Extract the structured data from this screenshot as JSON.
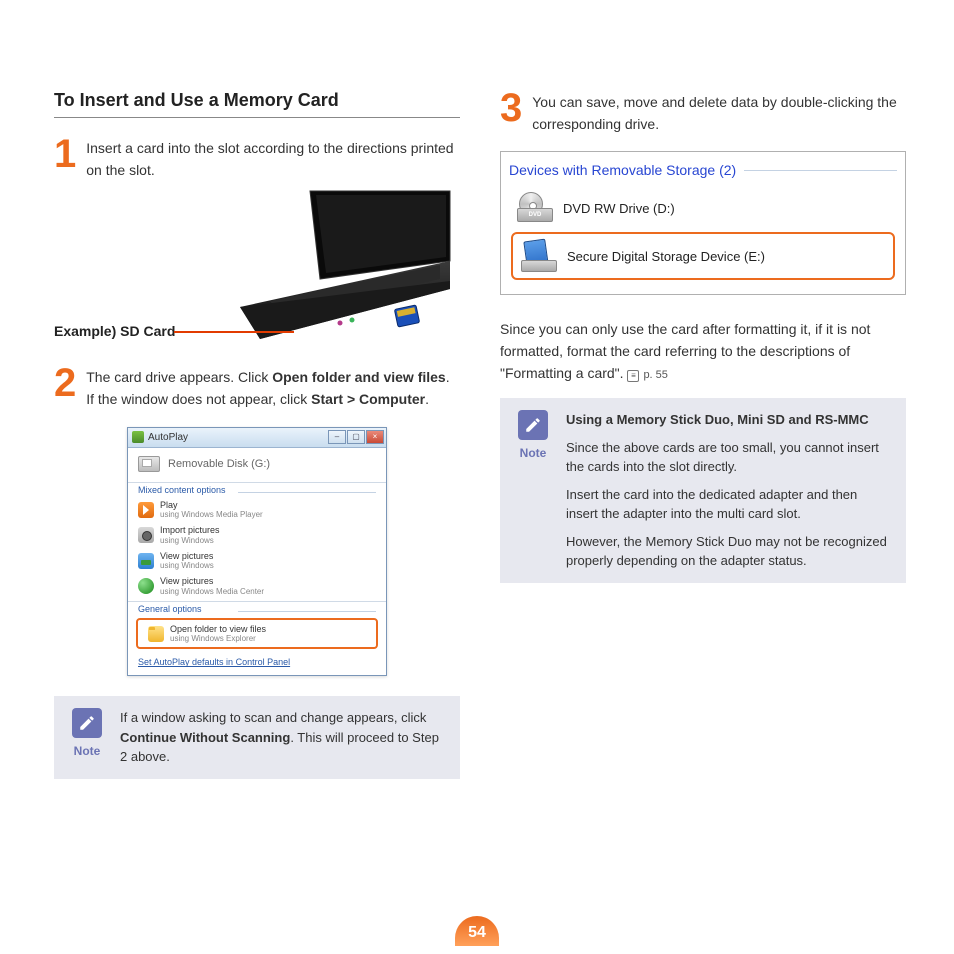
{
  "page_number": "54",
  "left": {
    "title": "To Insert and Use a Memory Card",
    "step1": {
      "num": "1",
      "text": "Insert a card into the slot according to the directions printed on the slot."
    },
    "example_label": "Example) SD Card",
    "step2": {
      "num": "2",
      "pre": "The card drive appears. Click ",
      "bold1": "Open folder and view files",
      "mid": ". If the window does not appear, click ",
      "bold2": "Start > Computer",
      "post": "."
    },
    "autoplay": {
      "title": "AutoPlay",
      "drive": "Removable Disk (G:)",
      "group_mixed": "Mixed content options",
      "opt_play_title": "Play",
      "opt_play_sub": "using Windows Media Player",
      "opt_import_title": "Import pictures",
      "opt_import_sub": "using Windows",
      "opt_view1_title": "View pictures",
      "opt_view1_sub": "using Windows",
      "opt_view2_title": "View pictures",
      "opt_view2_sub": "using Windows Media Center",
      "group_general": "General options",
      "opt_open_title": "Open folder to view files",
      "opt_open_sub": "using Windows Explorer",
      "cp_link": "Set AutoPlay defaults in Control Panel"
    },
    "note": {
      "label": "Note",
      "pre": "If a window asking to scan and change appears, click ",
      "bold": "Continue Without Scanning",
      "post": ". This will proceed to Step 2 above."
    }
  },
  "right": {
    "step3": {
      "num": "3",
      "text": "You can save, move and delete data by double-clicking the corresponding drive."
    },
    "devices": {
      "header": "Devices with Removable Storage (2)",
      "dvd_label": "DVD RW Drive (D:)",
      "dvd_badge": "DVD",
      "sd_label": "Secure Digital Storage Device (E:)"
    },
    "para": {
      "text": "Since you can only use the card after formatting it, if it is not formatted, format the card referring to the descriptions of \"Formatting a card\".",
      "pref": "p. 55"
    },
    "note": {
      "label": "Note",
      "heading": "Using a Memory Stick Duo, Mini SD and RS-MMC",
      "p1": "Since the above cards are too small, you cannot insert the cards into the slot directly.",
      "p2": "Insert the card into the dedicated adapter and then insert the adapter into the multi card slot.",
      "p3": "However, the Memory Stick Duo may not be recognized properly depending on the adapter status."
    }
  }
}
